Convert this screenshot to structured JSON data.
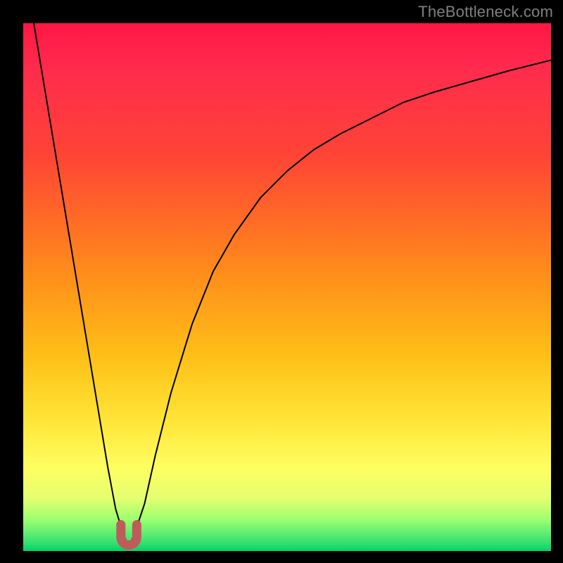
{
  "watermark": {
    "text": "TheBottleneck.com"
  },
  "chart_data": {
    "type": "line",
    "title": "",
    "xlabel": "",
    "ylabel": "",
    "xlim": [
      0,
      100
    ],
    "ylim": [
      0,
      100
    ],
    "grid": false,
    "legend": false,
    "background_gradient": {
      "top_color": "#ff1744",
      "bottom_color": "#00d26a",
      "description": "vertical red→orange→yellow→green gradient"
    },
    "series": [
      {
        "name": "bottleneck-curve",
        "color": "#000000",
        "x": [
          2,
          4,
          6,
          8,
          10,
          12,
          14,
          16,
          17.5,
          19,
          20,
          21,
          23,
          25,
          28,
          32,
          36,
          40,
          45,
          50,
          55,
          60,
          66,
          72,
          78,
          85,
          92,
          100
        ],
        "y": [
          100,
          88,
          76,
          64,
          52,
          40,
          28,
          16,
          8,
          3,
          1,
          3,
          9,
          18,
          30,
          43,
          53,
          60,
          67,
          72,
          76,
          79,
          82,
          85,
          87,
          89,
          91,
          93
        ]
      }
    ],
    "marker": {
      "name": "optimal-point-marker",
      "color": "#c15a5a",
      "shape": "u",
      "x_center": 20,
      "y_bottom": 1,
      "width": 3,
      "height": 4
    }
  }
}
